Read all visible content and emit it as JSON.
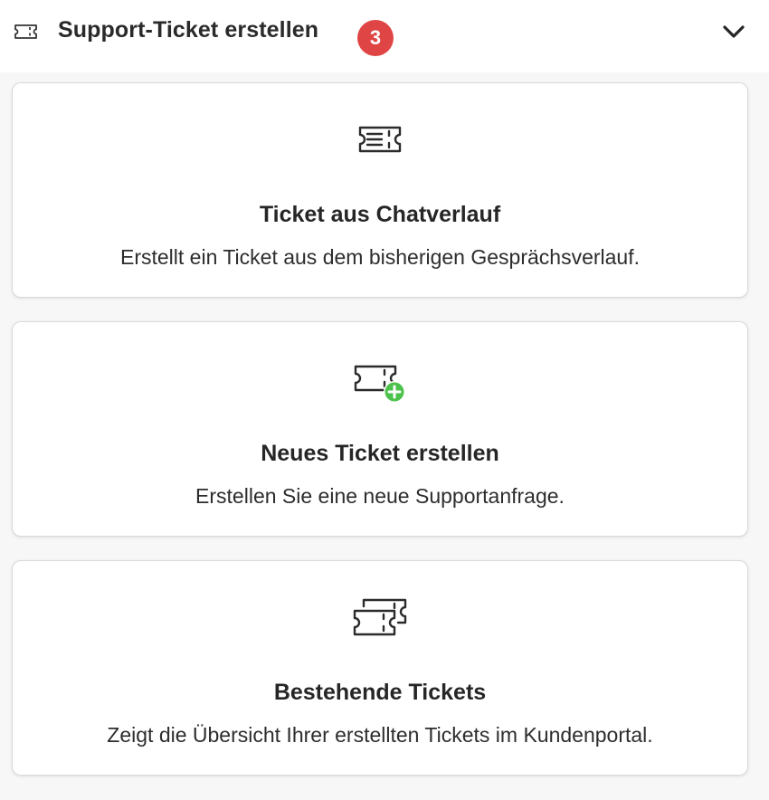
{
  "header": {
    "icon": "ticket-icon",
    "title": "Support-Ticket erstellen",
    "badge_count": "3",
    "badge_color": "#e04545",
    "toggle_icon": "chevron-down-icon"
  },
  "cards": [
    {
      "icon": "ticket-lines-icon",
      "title": "Ticket aus Chatverlauf",
      "description": "Erstellt ein Ticket aus dem bisherigen Gesprächsverlauf."
    },
    {
      "icon": "ticket-add-icon",
      "title": "Neues Ticket erstellen",
      "description": "Erstellen Sie eine neue Supportanfrage.",
      "accent_color": "#4cc24c"
    },
    {
      "icon": "tickets-stack-icon",
      "title": "Bestehende Tickets",
      "description": "Zeigt die Übersicht Ihrer erstellten Tickets im Kundenportal."
    }
  ]
}
